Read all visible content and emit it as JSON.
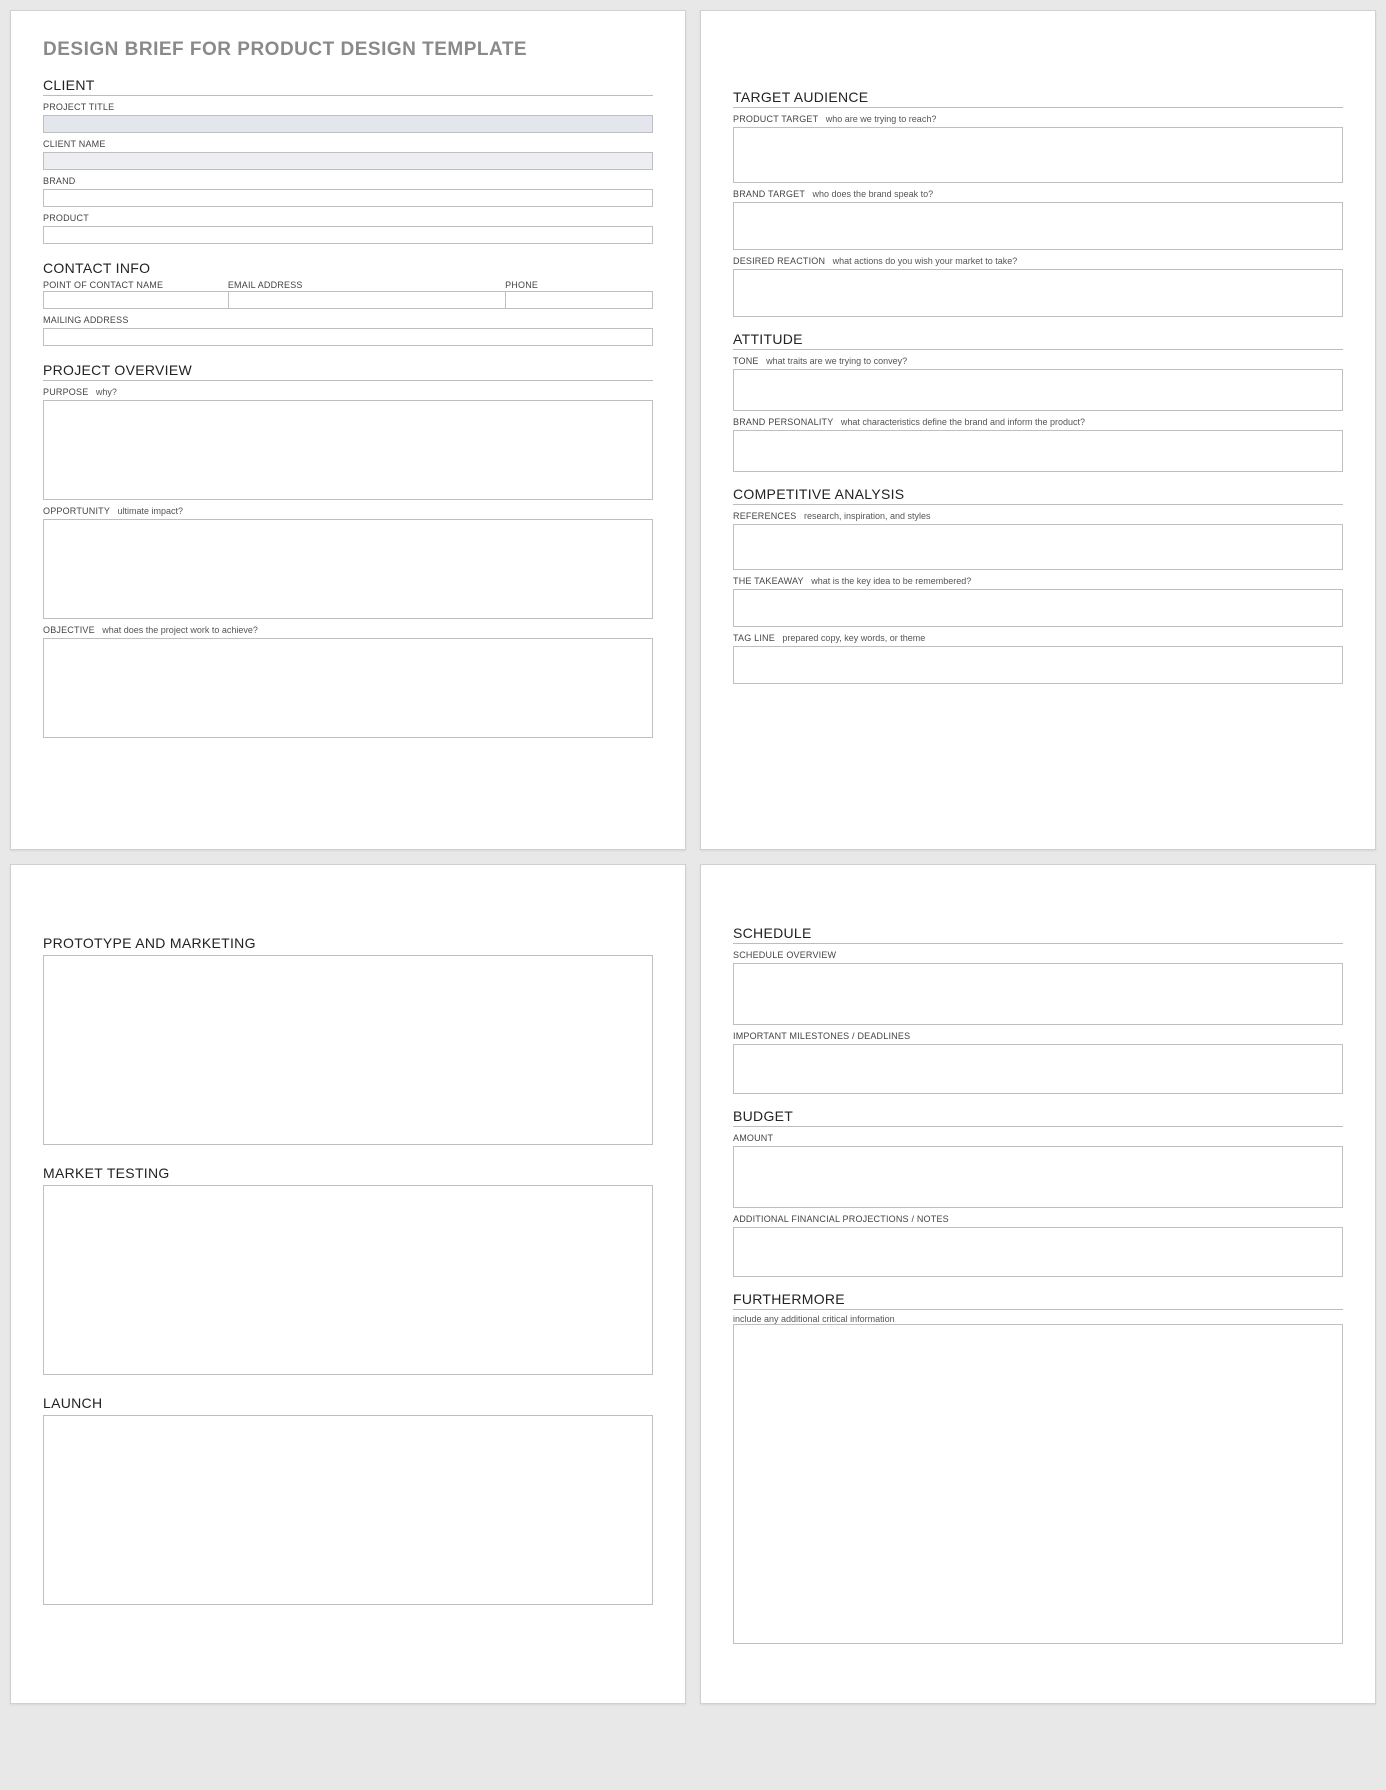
{
  "title": "DESIGN BRIEF FOR PRODUCT DESIGN TEMPLATE",
  "p1": {
    "client": {
      "heading": "CLIENT",
      "project_title": "PROJECT TITLE",
      "client_name": "CLIENT NAME",
      "brand": "BRAND",
      "product": "PRODUCT"
    },
    "contact": {
      "heading": "CONTACT INFO",
      "poc": "POINT OF CONTACT NAME",
      "email": "EMAIL ADDRESS",
      "phone": "PHONE",
      "mailing": "MAILING ADDRESS"
    },
    "overview": {
      "heading": "PROJECT OVERVIEW",
      "purpose": "PURPOSE",
      "purpose_hint": "why?",
      "opportunity": "OPPORTUNITY",
      "opportunity_hint": "ultimate impact?",
      "objective": "OBJECTIVE",
      "objective_hint": "what does the project work to achieve?"
    }
  },
  "p2": {
    "audience": {
      "heading": "TARGET AUDIENCE",
      "product_target": "PRODUCT TARGET",
      "product_target_hint": "who are we trying to reach?",
      "brand_target": "BRAND TARGET",
      "brand_target_hint": "who does the brand speak to?",
      "reaction": "DESIRED REACTION",
      "reaction_hint": "what actions do you wish your market to take?"
    },
    "attitude": {
      "heading": "ATTITUDE",
      "tone": "TONE",
      "tone_hint": "what traits are we trying to convey?",
      "personality": "BRAND PERSONALITY",
      "personality_hint": "what characteristics define the brand and inform the product?"
    },
    "competitive": {
      "heading": "COMPETITIVE ANALYSIS",
      "references": "REFERENCES",
      "references_hint": "research, inspiration, and styles",
      "takeaway": "THE TAKEAWAY",
      "takeaway_hint": "what is the key idea to be remembered?",
      "tagline": "TAG LINE",
      "tagline_hint": "prepared copy, key words, or theme"
    }
  },
  "p3": {
    "prototype": "PROTOTYPE AND MARKETING",
    "market": "MARKET TESTING",
    "launch": "LAUNCH"
  },
  "p4": {
    "schedule": {
      "heading": "SCHEDULE",
      "overview": "SCHEDULE OVERVIEW",
      "milestones": "IMPORTANT MILESTONES / DEADLINES"
    },
    "budget": {
      "heading": "BUDGET",
      "amount": "AMOUNT",
      "notes": "ADDITIONAL FINANCIAL PROJECTIONS / NOTES"
    },
    "furthermore": {
      "heading": "FURTHERMORE",
      "hint": "include any additional critical information"
    }
  }
}
